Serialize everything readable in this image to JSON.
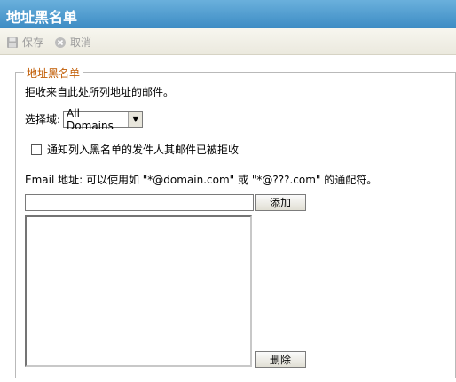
{
  "window": {
    "title": "地址黑名单"
  },
  "toolbar": {
    "save_label": "保存",
    "cancel_label": "取消"
  },
  "group": {
    "legend": "地址黑名单"
  },
  "description": "拒收来自此处所列地址的邮件。",
  "domain": {
    "label": "选择域:",
    "selected": "All Domains"
  },
  "notify": {
    "label": "通知列入黑名单的发件人其邮件已被拒收",
    "checked": false
  },
  "email": {
    "help": "Email 地址: 可以使用如 \"*@domain.com\" 或 \"*@???.com\" 的通配符。",
    "value": "",
    "add_label": "添加",
    "list_items": [],
    "delete_label": "删除"
  }
}
